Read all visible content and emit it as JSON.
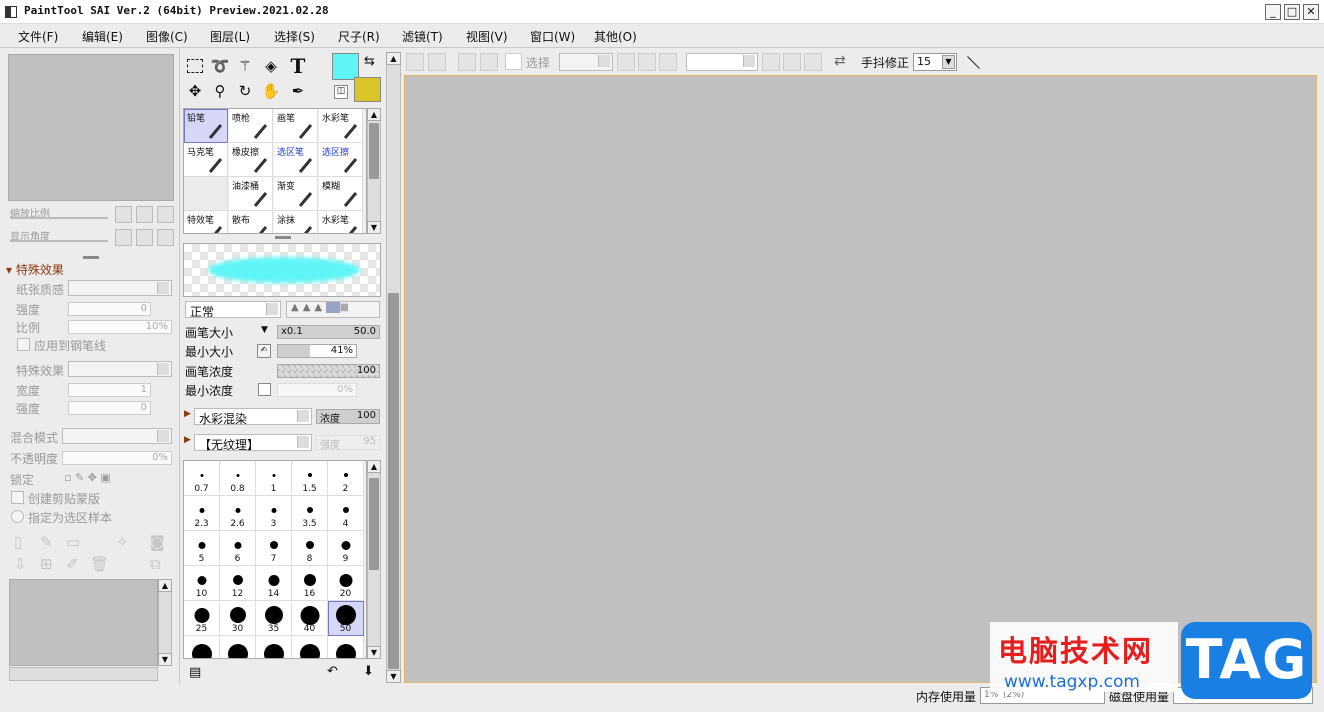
{
  "window": {
    "title": "PaintTool SAI Ver.2 (64bit) Preview.2021.02.28",
    "minimize": "_",
    "maximize": "□",
    "close": "✕"
  },
  "menu": [
    "文件(F)",
    "编辑(E)",
    "图像(C)",
    "图层(L)",
    "选择(S)",
    "尺子(R)",
    "滤镜(T)",
    "视图(V)",
    "窗口(W)",
    "其他(O)"
  ],
  "navigator": {
    "zoom_label": "缩放比例",
    "angle_label": "显示角度"
  },
  "effects": {
    "header": "特殊效果",
    "paper_label": "纸张质感",
    "strength_label": "强度",
    "strength_value": "0",
    "scale_label": "比例",
    "scale_value": "10%",
    "apply_pen_label": "应用到钢笔线",
    "effect_label": "特殊效果",
    "width_label": "宽度",
    "width_value": "1",
    "strength2_label": "强度",
    "strength2_value": "0"
  },
  "layer": {
    "blend_label": "混合模式",
    "opacity_label": "不透明度",
    "opacity_value": "0%",
    "lock_label": "锁定",
    "clip_label": "创建剪贴蒙版",
    "sample_label": "指定为选区样本"
  },
  "colors": {
    "primary": "#5ff5f7",
    "secondary": "#d9c52a",
    "stroke": "#5ff5f7"
  },
  "brushes": [
    {
      "label": "铅笔"
    },
    {
      "label": "喷枪"
    },
    {
      "label": "画笔"
    },
    {
      "label": "水彩笔"
    },
    {
      "label": "马克笔"
    },
    {
      "label": "橡皮擦"
    },
    {
      "label": "选区笔"
    },
    {
      "label": "选区擦"
    },
    {
      "label": ""
    },
    {
      "label": "油漆桶"
    },
    {
      "label": "渐变"
    },
    {
      "label": "模糊"
    },
    {
      "label": "特效笔"
    },
    {
      "label": "散布"
    },
    {
      "label": "涂抹"
    },
    {
      "label": "水彩笔"
    }
  ],
  "brush_settings": {
    "blend_mode": "正常",
    "size_label": "画笔大小",
    "size_mult": "x0.1",
    "size_value": "50.0",
    "min_size_label": "最小大小",
    "min_size_value": "41%",
    "min_size_fraction": 0.41,
    "density_label": "画笔浓度",
    "density_value": "100",
    "min_density_label": "最小浓度",
    "min_density_value": "0%",
    "water_mode": "水彩混染",
    "water_density_label": "浓度",
    "water_density_value": "100",
    "texture_mode": "【无纹理】",
    "texture_strength_label": "强度",
    "texture_strength_value": "95"
  },
  "sizes": [
    "0.7",
    "0.8",
    "1",
    "1.5",
    "2",
    "2.3",
    "2.6",
    "3",
    "3.5",
    "4",
    "5",
    "6",
    "7",
    "8",
    "9",
    "10",
    "12",
    "14",
    "16",
    "20",
    "25",
    "30",
    "35",
    "40",
    "50",
    "",
    "",
    "",
    "",
    ""
  ],
  "toolbar": {
    "select_label": "选择",
    "stabilizer_label": "手抖修正",
    "stabilizer_value": "15"
  },
  "status": {
    "memory_label": "内存使用量",
    "memory_value": "1%",
    "memory_value2": "(2%)",
    "disk_label": "磁盘使用量"
  },
  "watermark": {
    "text": "电脑技术网",
    "url": "www.tagxp.com",
    "logo": "TAG"
  }
}
